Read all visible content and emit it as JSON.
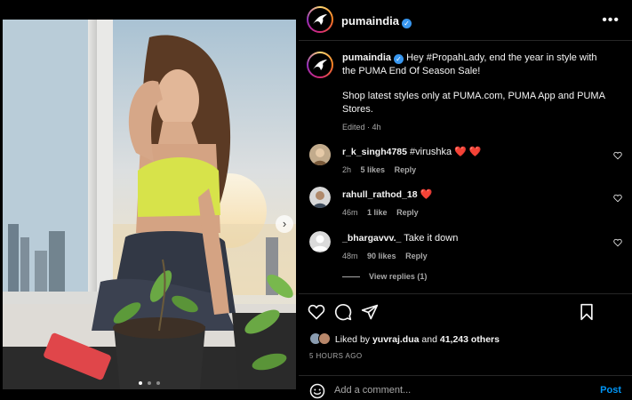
{
  "post": {
    "username": "pumaindia",
    "verified": true,
    "caption_part1": "Hey #PropahLady, end the year in style with the PUMA End Of Season Sale!",
    "caption_part2": "Shop latest styles only at PUMA.com, PUMA App and PUMA Stores.",
    "edited_label": "Edited",
    "edited_time": "4h"
  },
  "comments": [
    {
      "username": "r_k_singh4785",
      "text": "#virushka",
      "emoji": "❤️ ❤️",
      "time": "2h",
      "likes": "5 likes",
      "reply": "Reply"
    },
    {
      "username": "rahull_rathod_18",
      "text": "",
      "emoji": "❤️",
      "time": "46m",
      "likes": "1 like",
      "reply": "Reply"
    },
    {
      "username": "_bhargavvv._",
      "text": "Take it down",
      "emoji": "",
      "time": "48m",
      "likes": "90 likes",
      "reply": "Reply"
    }
  ],
  "view_replies": "View replies (1)",
  "likes_summary": {
    "prefix": "Liked by",
    "user": "yuvraj.dua",
    "joiner": "and",
    "others": "41,243 others"
  },
  "timestamp": "5 HOURS AGO",
  "comment_input": {
    "placeholder": "Add a comment...",
    "post_label": "Post"
  },
  "carousel": {
    "count": 3,
    "active": 0
  },
  "icons": [
    "more-icon",
    "heart-icon",
    "comment-icon",
    "share-icon",
    "bookmark-icon",
    "emoji-icon",
    "chevron-right-icon"
  ],
  "colors": {
    "verified": "#3897f0",
    "post_button": "#0095f6",
    "heart_red": "#ed4956",
    "top_yellow": "#d7e34a"
  }
}
